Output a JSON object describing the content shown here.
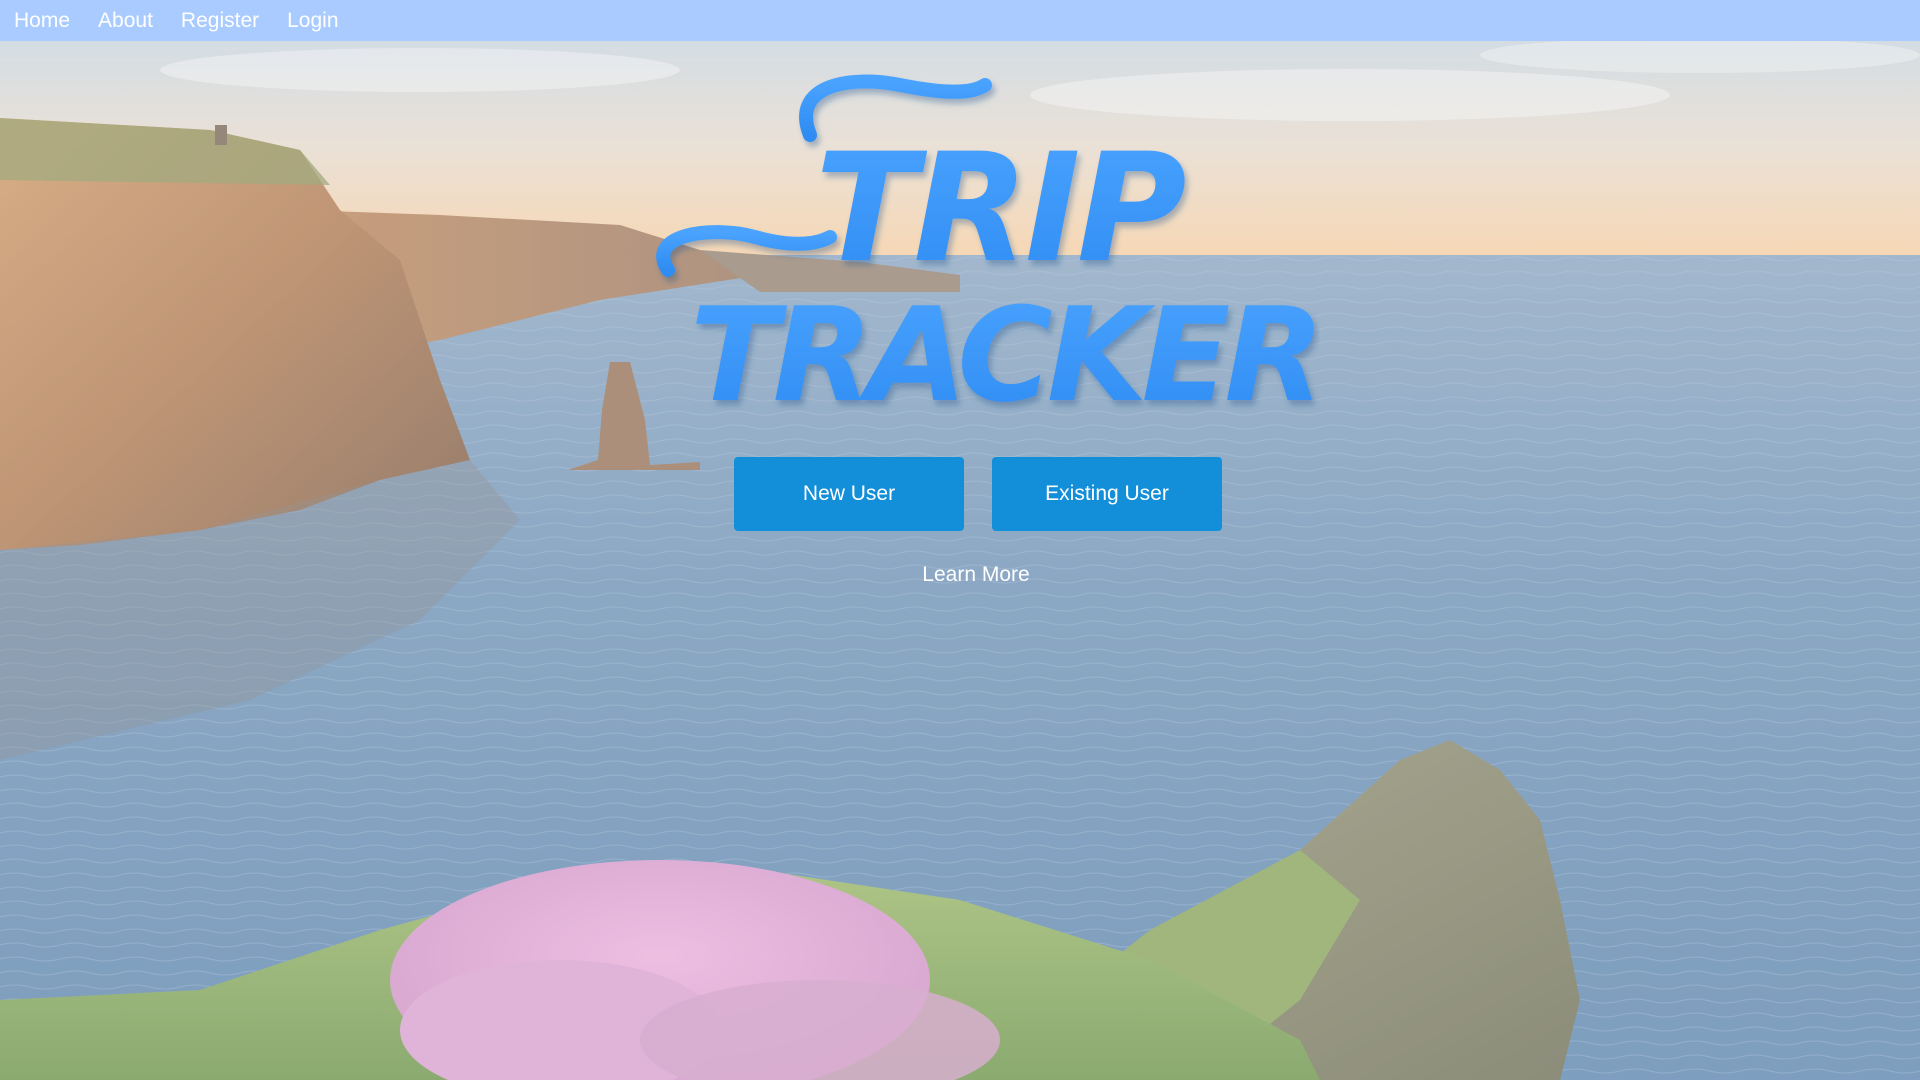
{
  "nav": {
    "items": [
      {
        "label": "Home"
      },
      {
        "label": "About"
      },
      {
        "label": "Register"
      },
      {
        "label": "Login"
      }
    ]
  },
  "hero": {
    "logo_line1": "TRIP",
    "logo_line2": "TRACKER",
    "new_user_label": "New User",
    "existing_user_label": "Existing User",
    "learn_more_label": "Learn More"
  },
  "colors": {
    "navbar": "#a9cbff",
    "button": "#138fd9",
    "logo": "#3d97f7"
  }
}
